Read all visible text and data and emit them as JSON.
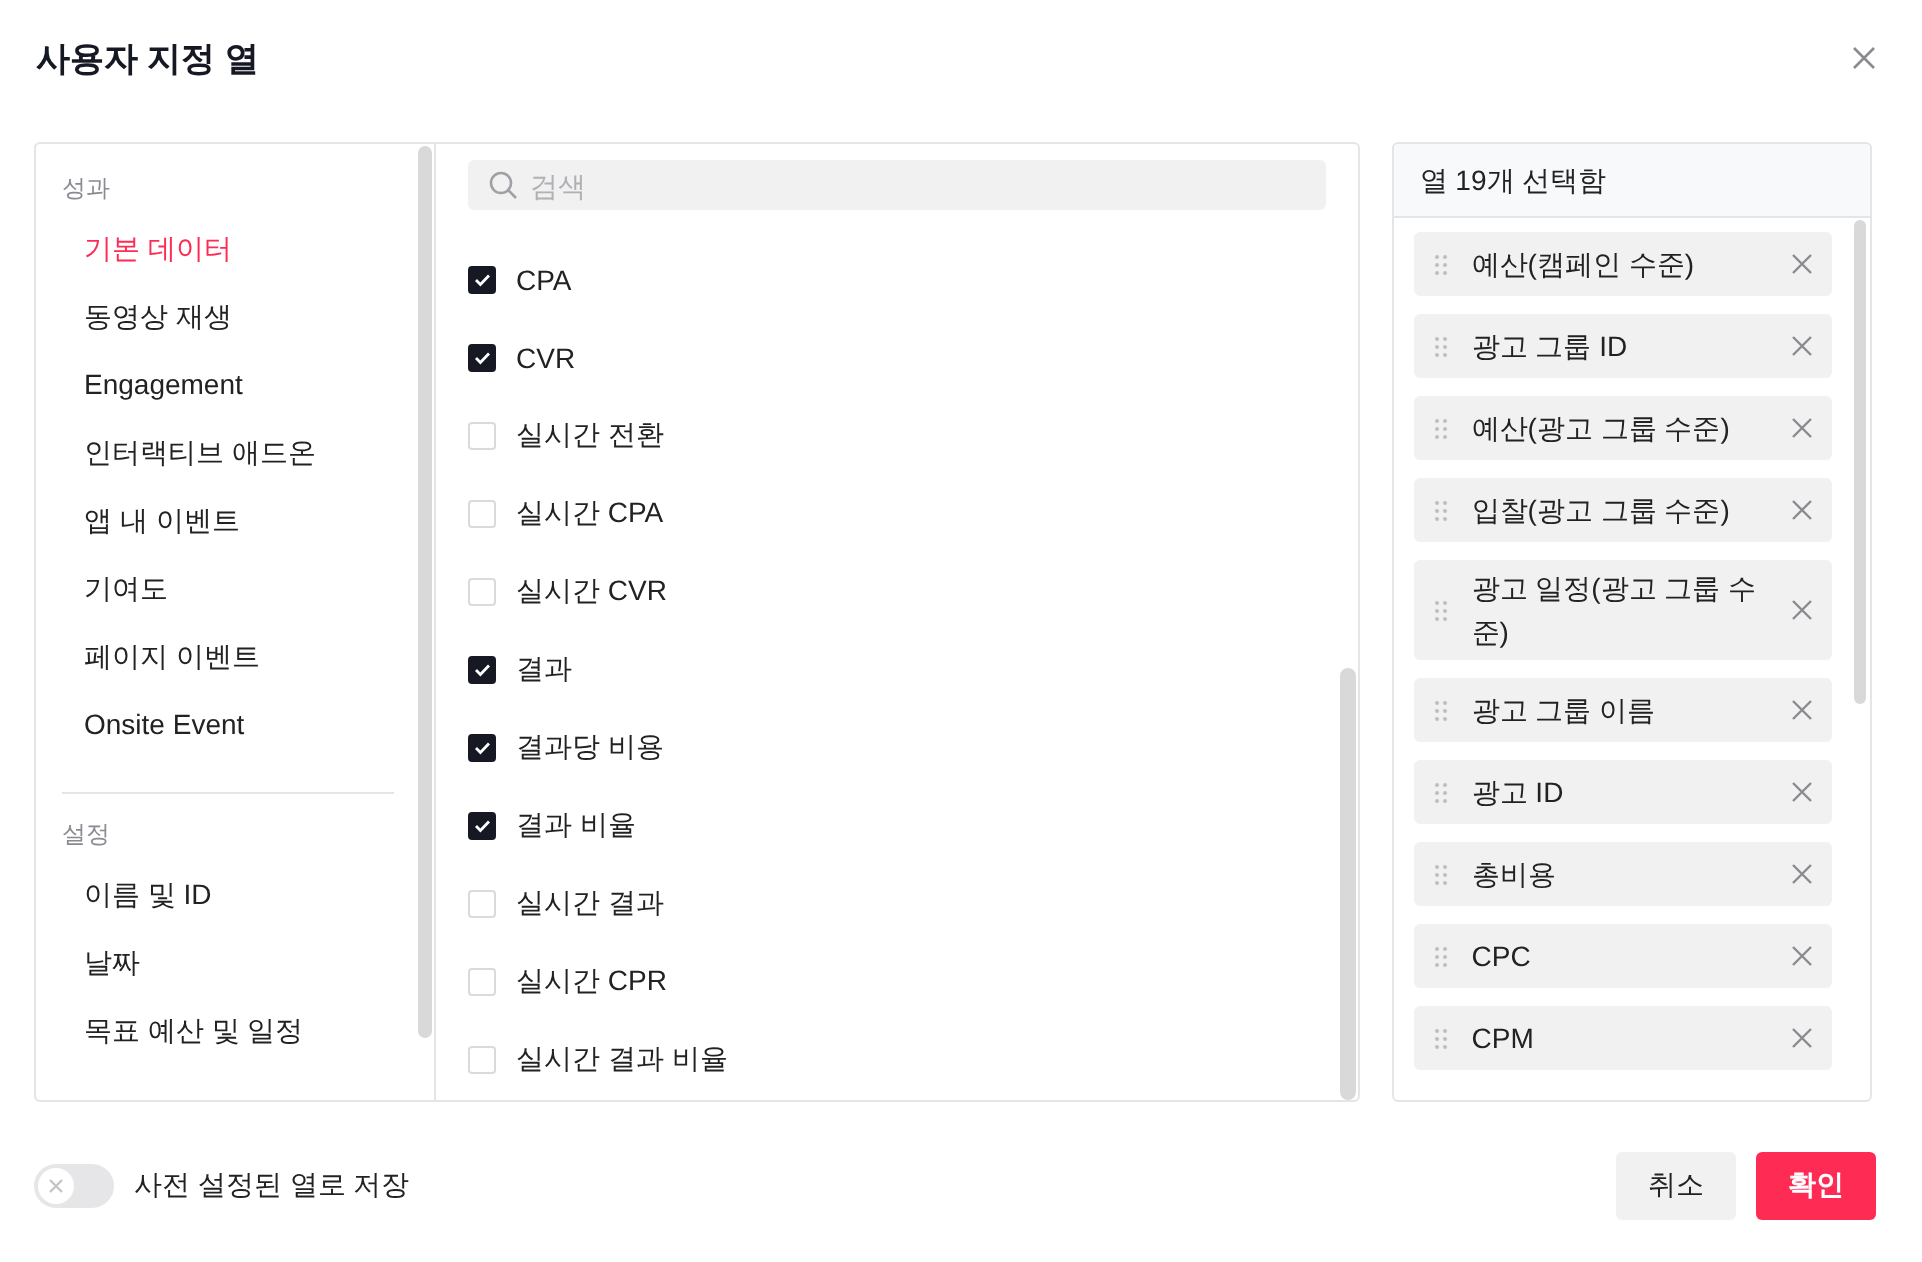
{
  "dialog": {
    "title": "사용자 지정 열"
  },
  "categories": [
    {
      "heading": "성과",
      "items": [
        {
          "label": "기본 데이터",
          "selected": true
        },
        {
          "label": "동영상 재생",
          "selected": false
        },
        {
          "label": "Engagement",
          "selected": false
        },
        {
          "label": "인터랙티브 애드온",
          "selected": false
        },
        {
          "label": "앱 내 이벤트",
          "selected": false
        },
        {
          "label": "기여도",
          "selected": false
        },
        {
          "label": "페이지 이벤트",
          "selected": false
        },
        {
          "label": "Onsite Event",
          "selected": false
        }
      ]
    },
    {
      "heading": "설정",
      "items": [
        {
          "label": "이름 및 ID",
          "selected": false
        },
        {
          "label": "날짜",
          "selected": false
        },
        {
          "label": "목표 예산 및 일정",
          "selected": false
        }
      ]
    }
  ],
  "search": {
    "placeholder": "검색"
  },
  "metrics": [
    {
      "label": "CPA",
      "checked": true
    },
    {
      "label": "CVR",
      "checked": true
    },
    {
      "label": "실시간 전환",
      "checked": false
    },
    {
      "label": "실시간 CPA",
      "checked": false
    },
    {
      "label": "실시간 CVR",
      "checked": false
    },
    {
      "label": "결과",
      "checked": true
    },
    {
      "label": "결과당 비용",
      "checked": true
    },
    {
      "label": "결과 비율",
      "checked": true
    },
    {
      "label": "실시간 결과",
      "checked": false
    },
    {
      "label": "실시간 CPR",
      "checked": false
    },
    {
      "label": "실시간 결과 비율",
      "checked": false
    }
  ],
  "selected_panel": {
    "header": "열 19개 선택함",
    "columns": [
      "예산(캠페인 수준)",
      "광고 그룹 ID",
      "예산(광고 그룹 수준)",
      "입찰(광고 그룹 수준)",
      "광고 일정(광고 그룹 수준)",
      "광고 그룹 이름",
      "광고 ID",
      "총비용",
      "CPC",
      "CPM"
    ]
  },
  "footer": {
    "toggle": {
      "label": "사전 설정된 열로 저장",
      "on": false
    },
    "buttons": [
      {
        "label": "취소",
        "kind": "secondary"
      },
      {
        "label": "확인",
        "kind": "primary"
      }
    ]
  }
}
